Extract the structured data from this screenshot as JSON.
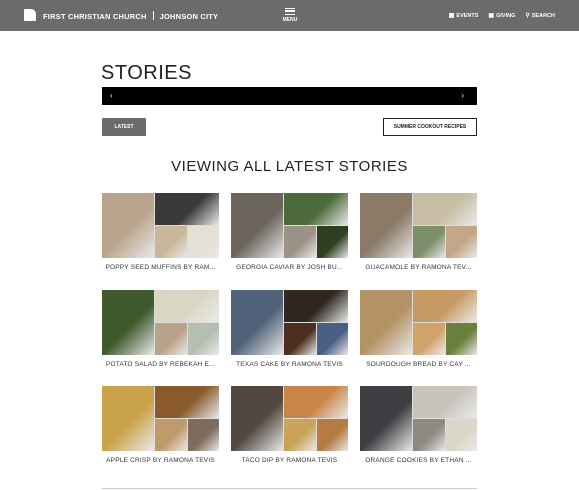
{
  "header": {
    "brand_name": "FIRST CHRISTIAN CHURCH",
    "brand_location": "JOHNSON CITY",
    "menu_label": "MENU",
    "nav": [
      {
        "label": "EVENTS",
        "icon": "calendar-icon"
      },
      {
        "label": "GIVING",
        "icon": "gift-icon"
      },
      {
        "label": "SEARCH",
        "icon": "search-icon"
      }
    ]
  },
  "page": {
    "title": "STORIES",
    "slider_prev": "‹",
    "slider_next": "›",
    "filter_latest": "LATEST",
    "filter_summer": "SUMMER COOKOUT RECIPES",
    "section_heading": "VIEWING ALL LATEST STORIES"
  },
  "stories": [
    {
      "caption": "POPPY SEED MUFFINS BY RAM...",
      "colors": [
        "#b9a58c",
        "#3a3a3a",
        "#c9b79a",
        "#e5dfd4"
      ]
    },
    {
      "caption": "GEORGIA CAVIAR BY JOSH BU...",
      "colors": [
        "#6b655c",
        "#4d6a3a",
        "#9c9287",
        "#2e3f1f"
      ]
    },
    {
      "caption": "GUACAMOLE BY RAMONA TEV...",
      "colors": [
        "#8b7a66",
        "#c6bda4",
        "#7c8f6a",
        "#c4a788"
      ]
    },
    {
      "caption": "POTATO SALAD BY REBEKAH E...",
      "colors": [
        "#3f5b2e",
        "#d9d6c4",
        "#b9a48a",
        "#b6c0b2"
      ]
    },
    {
      "caption": "TEXAS CAKE BY RAMONA TEVIS",
      "colors": [
        "#51637a",
        "#2f2720",
        "#4e2f1f",
        "#4b5f86"
      ]
    },
    {
      "caption": "SOURDOUGH BREAD BY CAY ...",
      "colors": [
        "#b49466",
        "#c79a63",
        "#d1a26c",
        "#69813c"
      ]
    },
    {
      "caption": "APPLE CRISP BY RAMONA TEVIS",
      "colors": [
        "#c9a24a",
        "#8b5a2b",
        "#bf9a6a",
        "#7d6b5c"
      ]
    },
    {
      "caption": "TACO DIP BY RAMONA TEVIS",
      "colors": [
        "#514940",
        "#c98448",
        "#caa25a",
        "#b67a44"
      ]
    },
    {
      "caption": "ORANGE COOKIES BY ETHAN ...",
      "colors": [
        "#3e3e42",
        "#c7c3ba",
        "#8e8a82",
        "#dcd6c8"
      ]
    }
  ]
}
